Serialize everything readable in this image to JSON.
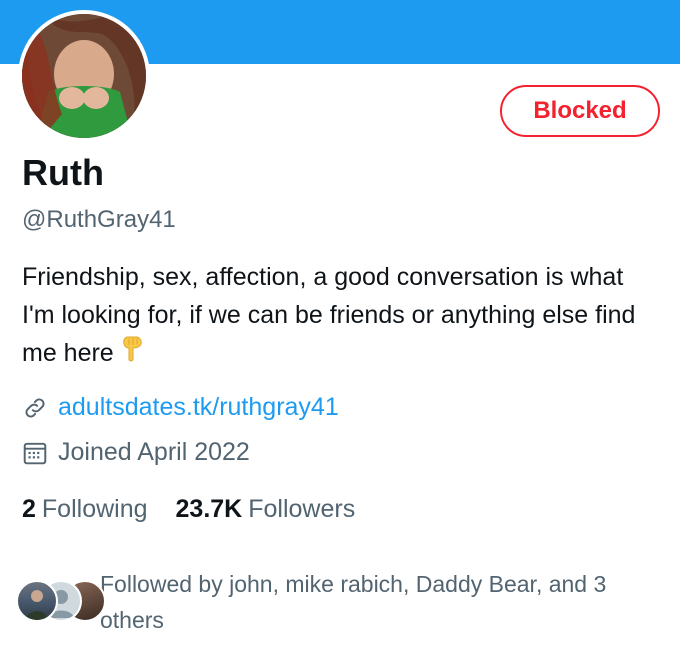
{
  "profile": {
    "name": "Ruth",
    "handle": "@RuthGray41",
    "bio": "Friendship, sex, affection, a good conversation is what I'm looking for, if we can be friends or anything else find me here",
    "bio_emoji": "pointing-down-emoji",
    "link": "adultsdates.tk/ruthgray41",
    "joined": "Joined April 2022"
  },
  "actions": {
    "blocked_label": "Blocked"
  },
  "stats": {
    "following_count": "2",
    "following_label": "Following",
    "followers_count": "23.7K",
    "followers_label": "Followers"
  },
  "followed_by": {
    "text": "Followed by john, mike rabich, Daddy Bear, and 3 others"
  },
  "colors": {
    "banner": "#1d9bf0",
    "link": "#1d9bf0",
    "blocked": "#f4212e",
    "secondary_text": "#536471"
  },
  "icons": {
    "link": "link-icon",
    "calendar": "calendar-icon"
  }
}
